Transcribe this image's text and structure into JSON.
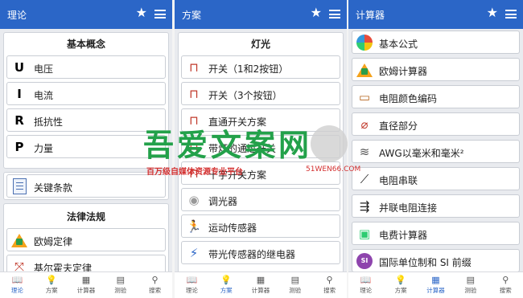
{
  "colors": {
    "accent": "#2b66c7",
    "watermark_green": "#23a14a",
    "watermark_red": "#d32f2f"
  },
  "panel1": {
    "title": "理论",
    "basic": {
      "header": "基本概念",
      "items": [
        {
          "letter": "U",
          "label": "电压"
        },
        {
          "letter": "I",
          "label": "电流"
        },
        {
          "letter": "R",
          "label": "抵抗性"
        },
        {
          "letter": "P",
          "label": "力量"
        }
      ]
    },
    "keyterms": {
      "icon": "document-icon",
      "label": "关键条款"
    },
    "law": {
      "header": "法律法规",
      "items": [
        {
          "icon": "ohm-triangle-icon",
          "label": "欧姆定律"
        },
        {
          "icon": "kirchhoff-icon",
          "label": "基尔霍夫定律"
        }
      ]
    }
  },
  "panel2": {
    "title": "方案",
    "light": {
      "header": "灯光",
      "items": [
        {
          "icon": "switch-icon",
          "label": "开关（1和2按钮）"
        },
        {
          "icon": "switch-icon",
          "label": "开关（3个按钮）"
        },
        {
          "icon": "switch-icon",
          "label": "直通开关方案"
        },
        {
          "icon": "switch-icon",
          "label": "带灯的通过开关"
        },
        {
          "icon": "switch-icon",
          "label": "十字开关方案"
        },
        {
          "icon": "dimmer-icon",
          "label": "调光器"
        },
        {
          "icon": "motion-icon",
          "label": "运动传感器"
        },
        {
          "icon": "relay-icon",
          "label": "带光传感器的继电器"
        }
      ]
    }
  },
  "panel3": {
    "title": "计算器",
    "items": [
      {
        "icon": "formula-wheel-icon",
        "label": "基本公式"
      },
      {
        "icon": "ohm-triangle-icon",
        "label": "欧姆计算器"
      },
      {
        "icon": "resistor-icon",
        "label": "电阻颜色编码"
      },
      {
        "icon": "wire-icon",
        "label": "直径部分"
      },
      {
        "icon": "awg-icon",
        "label": "AWG以毫米和毫米²"
      },
      {
        "icon": "series-icon",
        "label": "电阻串联"
      },
      {
        "icon": "parallel-icon",
        "label": "并联电阻连接"
      },
      {
        "icon": "bill-icon",
        "label": "电费计算器"
      },
      {
        "icon": "si-icon",
        "label": "国际单位制和 SI 前缀"
      }
    ]
  },
  "nav": [
    {
      "icon": "book-icon",
      "label": "理论"
    },
    {
      "icon": "bulb-icon",
      "label": "方案"
    },
    {
      "icon": "calculator-icon",
      "label": "计算器"
    },
    {
      "icon": "table-icon",
      "label": "测验"
    },
    {
      "icon": "search-icon",
      "label": "搜索"
    }
  ],
  "watermark": {
    "main": "吾爱文案网",
    "sub": "百万级自媒体资源专业平台",
    "url": "51WEN66.COM"
  }
}
